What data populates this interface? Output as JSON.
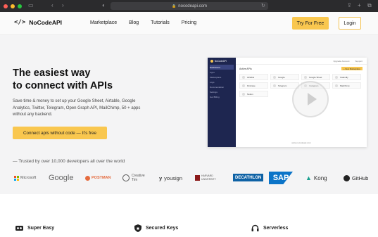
{
  "browser": {
    "url": "nocodeapi.com",
    "colors": {
      "close": "#ff5f57",
      "minimize": "#febc2e",
      "maximize": "#28c840"
    }
  },
  "nav": {
    "brand": "NoCodeAPI",
    "logo_mark": "</>",
    "links": [
      "Marketplace",
      "Blog",
      "Tutorials",
      "Pricing"
    ],
    "try_free": "Try For Free",
    "login": "Login",
    "accent": "#f9c74f"
  },
  "hero": {
    "headline_line1": "The easiest way",
    "headline_line2": "to connect with APIs",
    "description": "Save time & money to set up your Google Sheet, Airtable, Google Analytics, Twitter, Telegram, Open Graph API, MailChimp, 50 + apps without any backend.",
    "cta": "Connect apis without code — It's free",
    "trusted": "— Trusted by over 10,000 developers all over the world"
  },
  "dashboard": {
    "brand": "NoCodeAPI",
    "sidebar": [
      "Dashboard",
      "Apps",
      "Marketplace",
      "Logs",
      "Documentation",
      "Settings",
      "Get Billing"
    ],
    "top_links": [
      "Upgrade Account",
      "Support"
    ],
    "section_title": "Active APIs",
    "add_button": "+ New Marketplace",
    "tiles": [
      "Airtable",
      "Google",
      "Google Sheet",
      "Calendly",
      "Firebase",
      "Telegram",
      "Instagram",
      "Mailchimp",
      "Notion"
    ],
    "footer": "www.nocodeapi.com"
  },
  "logos": [
    "Microsoft",
    "Google",
    "POSTMAN",
    "Creative Tim",
    "yousign",
    "HARVARD UNIVERSITY",
    "DECATHLON",
    "SAP",
    "Kong",
    "GitHub"
  ],
  "features": [
    "Super Easy",
    "Secured Keys",
    "Serverless"
  ]
}
